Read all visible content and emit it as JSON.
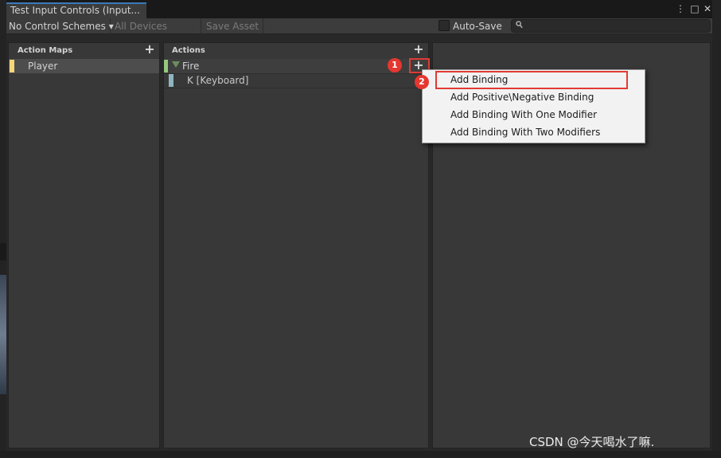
{
  "window": {
    "tab_title": "Test Input Controls (Input...",
    "menu_icon": "⋮",
    "maximize_icon": "□",
    "close_icon": "✕"
  },
  "toolbar": {
    "control_schemes": "No Control Schemes",
    "control_schemes_arrow": "▾",
    "devices": "All Devices",
    "save_asset": "Save Asset",
    "auto_save_label": "Auto-Save",
    "auto_save_checked": false,
    "search_placeholder": "",
    "search_icon": "🔍"
  },
  "action_maps": {
    "header": "Action Maps",
    "add_icon": "+",
    "items": [
      {
        "label": "Player",
        "color": "#f5d67a"
      }
    ]
  },
  "actions": {
    "header": "Actions",
    "add_icon": "+",
    "items": [
      {
        "label": "Fire",
        "color": "#93c97f",
        "bindings": [
          {
            "label": "K [Keyboard]",
            "color": "#8fb5bf"
          }
        ]
      }
    ],
    "add_binding_icon": "+"
  },
  "annotations": {
    "marker1": "1",
    "marker2": "2"
  },
  "context_menu": {
    "items": [
      "Add Binding",
      "Add Positive\\Negative Binding",
      "Add Binding With One Modifier",
      "Add Binding With Two Modifiers"
    ]
  },
  "watermark": "CSDN @今天喝水了嘛."
}
